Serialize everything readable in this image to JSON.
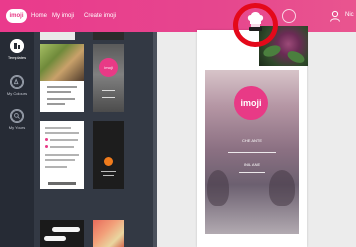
{
  "topbar": {
    "logo": "imoji",
    "nav": {
      "home": "Home",
      "my_imoji": "My imoji",
      "create_imoji": "Create imoji"
    },
    "user_name": "Nic",
    "icons": {
      "annotated": "chef-hat-icon",
      "circle_button": "circle-icon",
      "user": "user-icon"
    },
    "annotation_color": "#e4091a"
  },
  "rail": {
    "items": [
      {
        "label": "Templates",
        "icon": "template-icon"
      },
      {
        "label": "My Colours",
        "icon": "palette-icon"
      },
      {
        "label": "My Yours",
        "icon": "search-icon"
      }
    ]
  },
  "panel": {
    "grey_template_badge": "imoji"
  },
  "canvas": {
    "badge": "imoji",
    "line1": "CHE ANTE",
    "line2": "INIL ANE"
  },
  "colors": {
    "brand": "#e83a86",
    "rail": "#262b35",
    "panel": "#333944",
    "canvas_bg": "#ececec"
  }
}
